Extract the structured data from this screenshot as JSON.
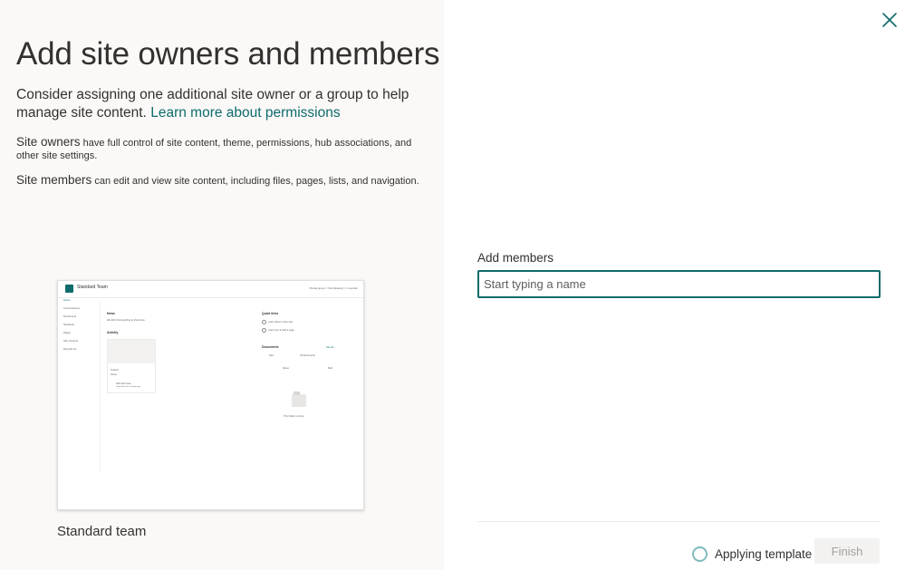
{
  "left": {
    "title": "Add site owners and members",
    "intro_text": "Consider assigning one additional site owner or a group to help manage site content.",
    "learn_more_link": "Learn more about permissions",
    "owners_term": "Site owners",
    "owners_desc": "have full control of site content, theme, permissions, hub associations, and other site settings.",
    "members_term": "Site members",
    "members_desc": "can edit and view site content, including files, pages, lists, and navigation.",
    "template_caption": "Standard team"
  },
  "preview": {
    "site_name": "Standard Team",
    "header_right": "Private group   ☆ Not following   ⚇ 1 member",
    "nav": [
      "Home",
      "Conversations",
      "Documents",
      "Notebook",
      "Pages",
      "Site contents",
      "Recycle bin"
    ],
    "news_title": "News",
    "news_empty": "We didn't find anything to show here.",
    "activity_title": "Activity",
    "card_name": "Ourtest",
    "card_sub": "Home",
    "card_author": "Nick Hermosa",
    "card_meta": "Viewed this site 2 minutes ago",
    "quick_links_title": "Quick links",
    "quick_links": [
      "Learn about a team site",
      "Learn how to add a page"
    ],
    "documents_title": "Documents",
    "see_all": "See all",
    "doc_new": "New",
    "doc_filter": "All Documents",
    "col_name": "Name",
    "col_mod": "Mod",
    "empty_folder": "This folder is empty"
  },
  "right": {
    "add_members_label": "Add members",
    "name_placeholder": "Start typing a name",
    "applying_status": "Applying template",
    "finish_label": "Finish"
  },
  "colors": {
    "accent": "#0f6b6b",
    "left_panel_bg": "#faf9f8"
  },
  "icons": {
    "close": "close-icon",
    "spinner": "loading-spinner-icon"
  }
}
